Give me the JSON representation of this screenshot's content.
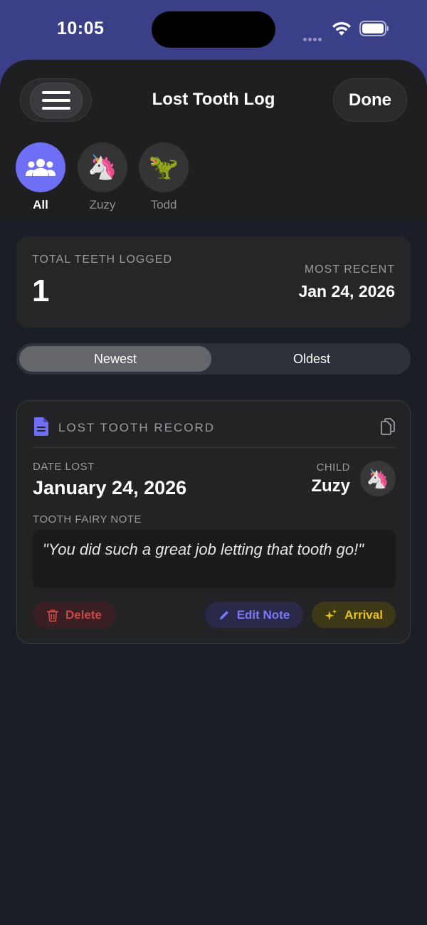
{
  "status_bar": {
    "time": "10:05"
  },
  "header": {
    "title": "Lost Tooth Log",
    "done_label": "Done",
    "menu_icon": "hamburger-icon"
  },
  "children": [
    {
      "label": "All",
      "icon": "group-icon",
      "active": true
    },
    {
      "label": "Zuzy",
      "icon": "🦄",
      "active": false
    },
    {
      "label": "Todd",
      "icon": "🦖",
      "active": false
    }
  ],
  "stats": {
    "total_label": "TOTAL TEETH LOGGED",
    "total_value": "1",
    "recent_label": "MOST RECENT",
    "recent_value": "Jan 24, 2026"
  },
  "sort": {
    "options": [
      "Newest",
      "Oldest"
    ],
    "selected": "Newest"
  },
  "record": {
    "title": "LOST TOOTH RECORD",
    "date_label": "DATE LOST",
    "date_value": "January 24, 2026",
    "child_label": "CHILD",
    "child_name": "Zuzy",
    "child_emoji": "🦄",
    "note_label": "TOOTH FAIRY NOTE",
    "note_text": "\"You did such a great job letting that tooth go!\"",
    "actions": {
      "delete": "Delete",
      "edit": "Edit Note",
      "arrival": "Arrival"
    }
  },
  "colors": {
    "accent": "#6f6ff5",
    "delete": "#c84848",
    "edit": "#7a7af5",
    "arrival": "#e6c220",
    "status_bar_bg": "#3b3f87"
  }
}
